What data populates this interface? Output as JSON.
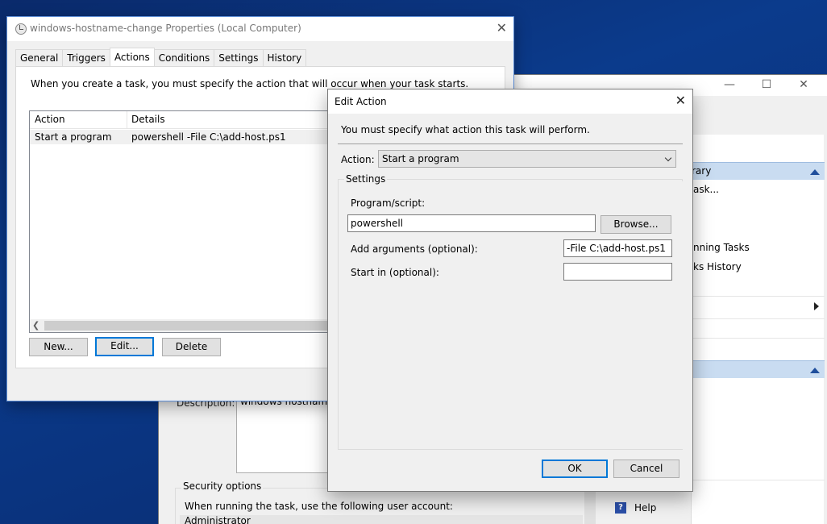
{
  "background_window": {
    "description_label": "Description:",
    "description_value": "windows hostname c",
    "security_group": "Security options",
    "security_text": "When running the task, use the following user account:",
    "user_account": "Administrator",
    "right_pane": {
      "library_suffix": "rary",
      "create_task_suffix": "ask...",
      "running_tasks_suffix": "nning Tasks",
      "tasks_history_suffix": "ks History",
      "help": "Help"
    }
  },
  "properties_dialog": {
    "title": "windows-hostname-change Properties (Local Computer)",
    "tabs": [
      {
        "label": "General"
      },
      {
        "label": "Triggers"
      },
      {
        "label": "Actions",
        "active": true
      },
      {
        "label": "Conditions"
      },
      {
        "label": "Settings"
      },
      {
        "label": "History"
      }
    ],
    "intro": "When you create a task, you must specify the action that will occur when your task starts.",
    "columns": [
      "Action",
      "Details"
    ],
    "rows": [
      {
        "action": "Start a program",
        "details": "powershell -File C:\\add-host.ps1"
      }
    ],
    "buttons": {
      "new": "New...",
      "edit": "Edit...",
      "delete": "Delete"
    }
  },
  "edit_action_dialog": {
    "title": "Edit Action",
    "info": "You must specify what action this task will perform.",
    "action_label": "Action:",
    "action_value": "Start a program",
    "settings_label": "Settings",
    "program_label": "Program/script:",
    "program_value": "powershell",
    "browse_button": "Browse...",
    "arguments_label": "Add arguments (optional):",
    "arguments_value": "-File C:\\add-host.ps1",
    "start_in_label": "Start in (optional):",
    "start_in_value": "",
    "ok_button": "OK",
    "cancel_button": "Cancel"
  },
  "colors": {
    "desktop": "#0b3b8c",
    "focus_border": "#0078d7",
    "pane_header": "#c9dcf1"
  }
}
